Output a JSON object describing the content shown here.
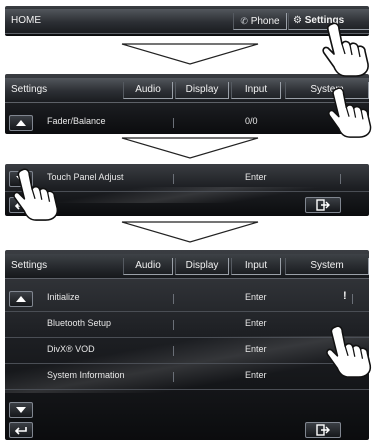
{
  "step1": {
    "title": "HOME",
    "phone_label": "Phone",
    "settings_label": "Settings"
  },
  "step2": {
    "title": "Settings",
    "tabs": [
      "Audio",
      "Display",
      "Input",
      "System"
    ],
    "row_label": "Fader/Balance",
    "row_value": "0/0"
  },
  "step3": {
    "row_label": "Touch Panel Adjust",
    "row_value": "Enter"
  },
  "step4": {
    "title": "Settings",
    "tabs": [
      "Audio",
      "Display",
      "Input",
      "System"
    ],
    "rows": [
      {
        "label": "Initialize",
        "value": "Enter",
        "badge": "!"
      },
      {
        "label": "Bluetooth Setup",
        "value": "Enter"
      },
      {
        "label": "DivX® VOD",
        "value": "Enter"
      },
      {
        "label": "System Information",
        "value": "Enter"
      }
    ]
  },
  "icons": [
    "phone-icon",
    "gear-icon",
    "up-arrow-icon",
    "down-arrow-icon",
    "back-icon",
    "exit-icon",
    "pointing-hand-icon",
    "step-arrow-icon"
  ]
}
